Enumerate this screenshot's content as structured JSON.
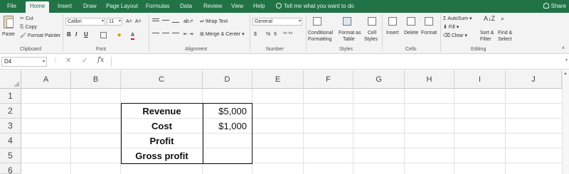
{
  "tabs": [
    "File",
    "Home",
    "Insert",
    "Draw",
    "Page Layout",
    "Formulas",
    "Data",
    "Review",
    "View",
    "Help"
  ],
  "active_tab": "Home",
  "tell_me": "Tell me what you want to do",
  "share": "Share",
  "ribbon": {
    "clipboard": {
      "paste": "Paste",
      "cut": "Cut",
      "copy": "Copy",
      "format_painter": "Format Painter",
      "label": "Clipboard"
    },
    "font": {
      "name": "Calibri",
      "size": "11",
      "label": "Font",
      "bold": "B",
      "italic": "I",
      "underline": "U"
    },
    "alignment": {
      "wrap_text": "Wrap Text",
      "merge_center": "Merge & Center",
      "label": "Alignment"
    },
    "number": {
      "format": "General",
      "currency": "$",
      "percent": "%",
      "comma": "9",
      "label": "Number"
    },
    "styles": {
      "conditional": "Conditional",
      "formatting": "Formatting",
      "format_as": "Format as",
      "table": "Table",
      "cell": "Cell",
      "styles_btn": "Styles",
      "label": "Styles"
    },
    "cells": {
      "insert": "Insert",
      "delete": "Delete",
      "format": "Format",
      "label": "Cells"
    },
    "editing": {
      "autosum": "AutoSum",
      "fill": "Fill",
      "clear": "Clear",
      "sort": "Sort &",
      "filter": "Filter",
      "find": "Find &",
      "select": "Select",
      "label": "Editing"
    }
  },
  "formula_bar": {
    "name_box": "D4",
    "fx": "fx",
    "content": ""
  },
  "columns": [
    "A",
    "B",
    "C",
    "D",
    "E",
    "F",
    "G",
    "H",
    "I",
    "J"
  ],
  "rows": [
    "1",
    "2",
    "3",
    "4",
    "5",
    "6"
  ],
  "cells": {
    "C2": "Revenue",
    "D2": "$5,000",
    "C3": "Cost",
    "D3": "$1,000",
    "C4": "Profit",
    "D4": "",
    "C5": "Gross profit",
    "D5": ""
  },
  "colors": {
    "brand": "#217346",
    "ribbon": "#f3f3f3",
    "header": "#f3f3f3"
  }
}
